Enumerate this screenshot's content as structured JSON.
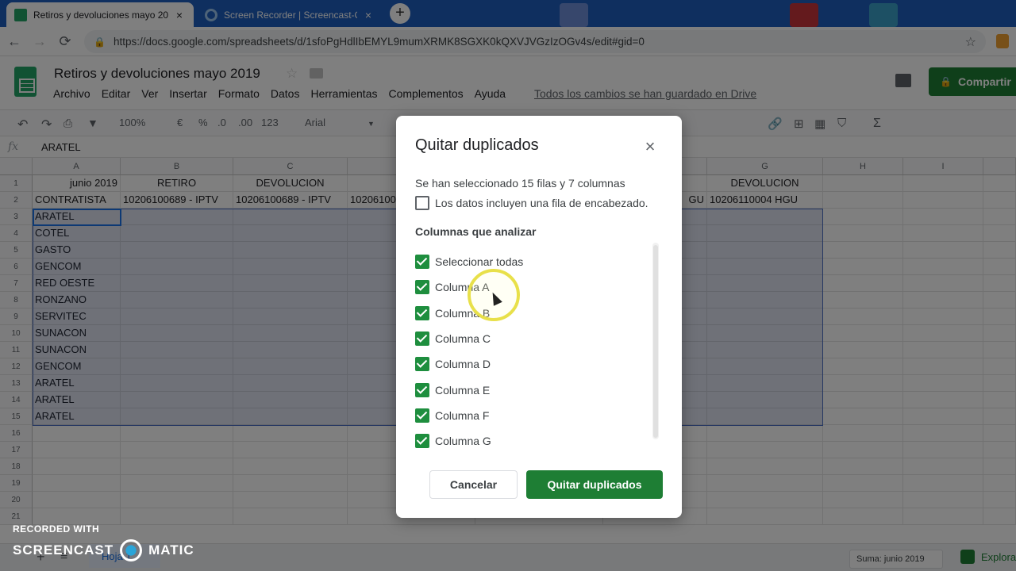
{
  "browser": {
    "tabs": [
      {
        "title": "Retiros y devoluciones mayo 2019",
        "close": "×"
      },
      {
        "title": "Screen Recorder | Screencast-O-Matic",
        "close": "×"
      }
    ],
    "new_tab": "+",
    "url": "https://docs.google.com/spreadsheets/d/1sfoPgHdlIbEMYL9mumXRMK8SGXK0kQXVJVGzIzOGv4s/edit#gid=0",
    "nav": {
      "back": "←",
      "forward": "→",
      "reload": "⟳"
    },
    "star": "☆",
    "lock": "🔒"
  },
  "sheets": {
    "title": "Retiros y devoluciones mayo 2019",
    "menu": [
      "Archivo",
      "Editar",
      "Ver",
      "Insertar",
      "Formato",
      "Datos",
      "Herramientas",
      "Complementos",
      "Ayuda"
    ],
    "saved_status": "Todos los cambios se han guardado en Drive",
    "share_label": "Compartir",
    "toolbar": {
      "zoom": "100%",
      "currency": "€",
      "percent": "%",
      "dec_less": ".0",
      "dec_more": ".00",
      "format": "123",
      "font": "Arial"
    },
    "formula": {
      "fx": "fx",
      "value": "ARATEL"
    }
  },
  "grid": {
    "columns": [
      "A",
      "B",
      "C",
      "D",
      "E",
      "F",
      "G",
      "H",
      "I"
    ],
    "row_numbers": [
      "1",
      "2",
      "3",
      "4",
      "5",
      "6",
      "7",
      "8",
      "9",
      "10",
      "11",
      "12",
      "13",
      "14",
      "15",
      "16",
      "17",
      "18",
      "19",
      "20",
      "21"
    ],
    "row1": [
      "junio 2019",
      "RETIRO",
      "DEVOLUCION",
      "",
      "",
      "",
      "DEVOLUCION"
    ],
    "row2": [
      "CONTRATISTA",
      "10206100689 - IPTV",
      "10206100689 - IPTV",
      "10206100",
      "",
      "GU",
      "10206110004 HGU"
    ],
    "colA": [
      "ARATEL",
      "COTEL",
      "GASTO",
      "GENCOM",
      "RED OESTE",
      "RONZANO",
      "SERVITEC",
      "SUNACON",
      "SUNACON",
      "GENCOM",
      "ARATEL",
      "ARATEL",
      "ARATEL"
    ]
  },
  "bottom": {
    "sheet_tab": "Hoja 1",
    "sum": "Suma: junio 2019",
    "explore": "Explorar"
  },
  "watermark": {
    "line1": "RECORDED WITH",
    "left": "SCREENCAST",
    "right": "MATIC"
  },
  "dialog": {
    "title": "Quitar duplicados",
    "close": "×",
    "info": "Se han seleccionado 15 filas y 7 columnas",
    "header_checkbox": {
      "label": "Los datos incluyen una fila de encabezado.",
      "checked": false
    },
    "section": "Columnas que analizar",
    "columns": [
      {
        "label": "Seleccionar todas",
        "checked": true
      },
      {
        "label": "Columna A",
        "checked": true
      },
      {
        "label": "Columna B",
        "checked": true
      },
      {
        "label": "Columna C",
        "checked": true
      },
      {
        "label": "Columna D",
        "checked": true
      },
      {
        "label": "Columna E",
        "checked": true
      },
      {
        "label": "Columna F",
        "checked": true
      },
      {
        "label": "Columna G",
        "checked": true
      }
    ],
    "cancel": "Cancelar",
    "confirm": "Quitar duplicados"
  }
}
